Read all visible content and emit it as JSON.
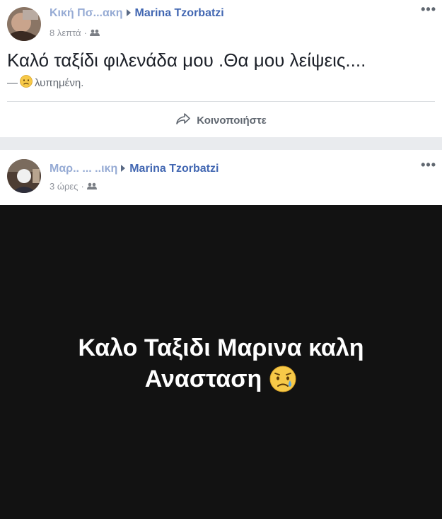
{
  "posts": [
    {
      "author": "Κική Πσ...ακη",
      "target": "Marina Tzorbatzi",
      "time": "8 λεπτά",
      "separator": "·",
      "privacy_icon": "friends-icon",
      "more": "•••",
      "text": "Καλό ταξίδι φιλενάδα μου .Θα μου λείψεις....",
      "feeling_prefix": "—",
      "feeling_icon": "sad-face-emoji",
      "feeling": "λυπημένη.",
      "share_label": "Κοινοποιήστε"
    },
    {
      "author": "Μαρ.. ... ..ικη",
      "target": "Marina Tzorbatzi",
      "time": "3 ώρες",
      "separator": "·",
      "privacy_icon": "friends-icon",
      "more": "•••",
      "image_text_line1": "Καλο Ταξιδι Μαρινα καλη",
      "image_text_line2": "Ανασταση",
      "image_emoji_icon": "sad-tear-emoji"
    }
  ],
  "colors": {
    "link": "#4267b2",
    "meta": "#90949c",
    "background": "#e9ebee",
    "image_bg": "#121212"
  }
}
